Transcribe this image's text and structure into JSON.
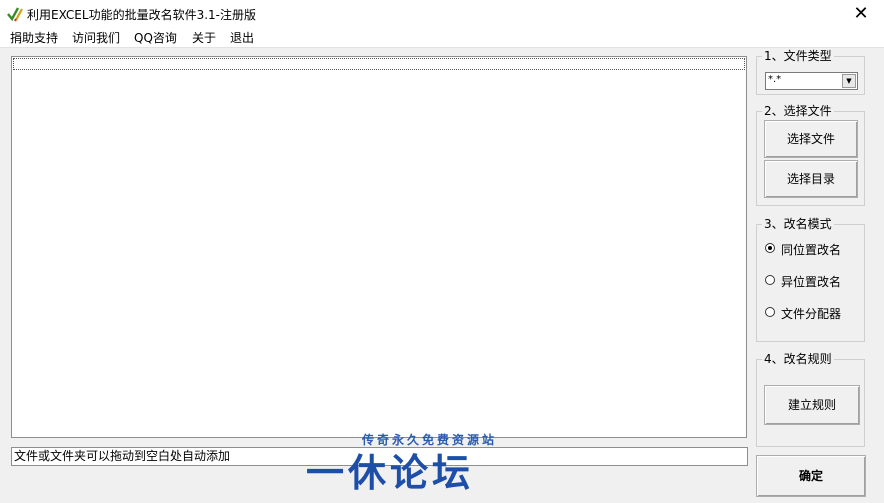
{
  "window": {
    "title": "利用EXCEL功能的批量改名软件3.1-注册版",
    "close_glyph": "✕"
  },
  "menu": {
    "items": [
      "捐助支持",
      "访问我们",
      "QQ咨询",
      "关于",
      "退出"
    ]
  },
  "status_text": "文件或文件夹可以拖动到空白处自动添加",
  "groups": {
    "file_type": {
      "label": "1、文件类型",
      "selected": "*.*"
    },
    "select_files": {
      "label": "2、选择文件",
      "select_file_button": "选择文件",
      "select_dir_button": "选择目录"
    },
    "rename_mode": {
      "label": "3、改名模式",
      "options": [
        "同位置改名",
        "异位置改名",
        "文件分配器"
      ],
      "selected_index": 0
    },
    "rename_rule": {
      "label": "4、改名规则",
      "build_rule_button": "建立规则"
    }
  },
  "confirm_button": "确定",
  "watermark": {
    "small": "传奇永久免费资源站",
    "big": "一休论坛"
  },
  "icons": {
    "app": "checkmark-pencil-icon",
    "close": "close-icon"
  },
  "colors": {
    "watermark": "#1d4fa8",
    "titlebar": "#ffffff",
    "window_bg": "#f0f0f0"
  }
}
